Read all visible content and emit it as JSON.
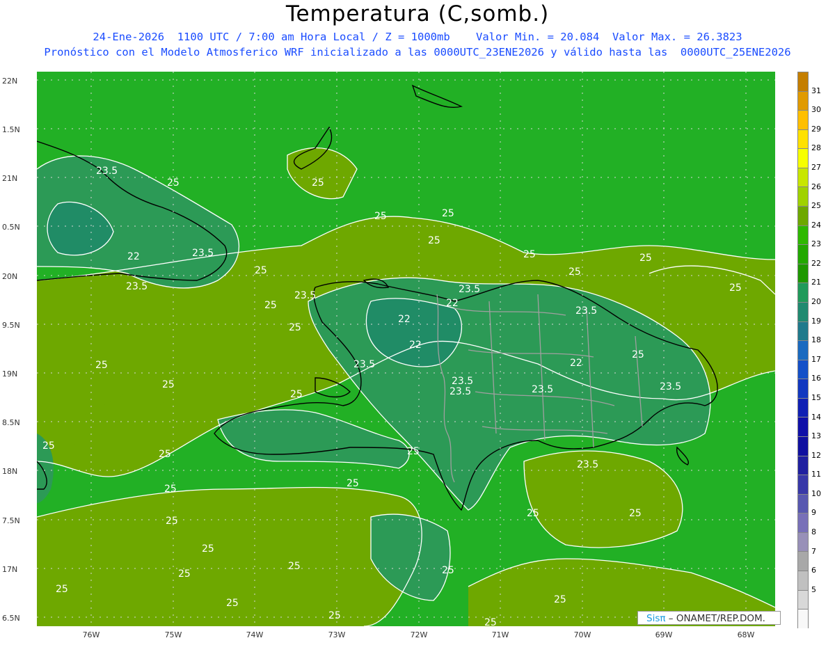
{
  "header": {
    "title": "Temperatura (C,somb.)",
    "line1": "24-Ene-2026  1100 UTC / 7:00 am Hora Local / Z = 1000mb    Valor Min. = 20.084  Valor Max. = 26.3823",
    "line2": "Pronóstico con el Modelo Atmosferico WRF inicializado a las 0000UTC_23ENE2026 y válido hasta las  0000UTC_25ENE2026"
  },
  "axes": {
    "lat_labels": [
      "22N",
      "1.5N",
      "21N",
      "0.5N",
      "20N",
      "9.5N",
      "19N",
      "8.5N",
      "18N",
      "7.5N",
      "17N",
      "6.5N"
    ],
    "lon_labels": [
      "76W",
      "75W",
      "74W",
      "73W",
      "72W",
      "71W",
      "70W",
      "69W",
      "68W"
    ]
  },
  "contour_labels": [
    "23.5",
    "25",
    "25",
    "25",
    "25",
    "25",
    "25",
    "25",
    "22",
    "23.5",
    "23.5",
    "23.5",
    "25",
    "25",
    "25",
    "25",
    "25",
    "25",
    "25",
    "25",
    "23.5",
    "22",
    "22",
    "22",
    "23.5",
    "23.5",
    "23.5",
    "23.5",
    "22",
    "23.5",
    "23.5",
    "23.5",
    "25",
    "25",
    "25",
    "25",
    "25",
    "25",
    "25",
    "25",
    "25",
    "25",
    "25",
    "25",
    "25",
    "25",
    "25",
    "25",
    "25",
    "25"
  ],
  "colorbar": {
    "ticks": [
      "31",
      "30",
      "29",
      "28",
      "27",
      "26",
      "25",
      "24",
      "23",
      "22",
      "21",
      "20",
      "19",
      "18",
      "17",
      "16",
      "15",
      "14",
      "13",
      "12",
      "11",
      "10",
      "9",
      "8",
      "7",
      "6",
      "5"
    ],
    "colors": [
      "#c47e00",
      "#e09a00",
      "#ffbf00",
      "#ffe100",
      "#f7ff00",
      "#c8e600",
      "#a0d200",
      "#6ea800",
      "#2eb800",
      "#22a800",
      "#1e9800",
      "#209a5a",
      "#208a70",
      "#1f7a8c",
      "#1a6ac0",
      "#1450c8",
      "#1238c0",
      "#1020b4",
      "#1010a8",
      "#1010a0",
      "#2020a0",
      "#3838a8",
      "#5858b0",
      "#7870b8",
      "#9890b8",
      "#a8a8a8",
      "#c0c0c0",
      "#d8d8d8",
      "#f8f8f8"
    ]
  },
  "credit": {
    "brand": "Sisπ",
    "text": "– ONAMET/REP.DOM."
  },
  "colors": {
    "sea": "#22b025",
    "warm": "#6ea800",
    "cool": "#2c9a56",
    "contour": "#ffffff",
    "border": "#999999"
  }
}
